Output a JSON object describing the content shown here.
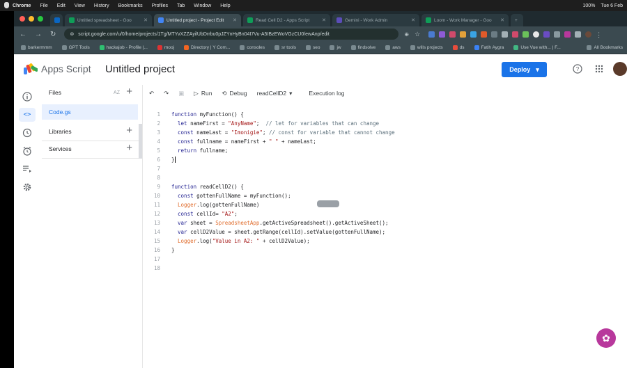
{
  "mac_menu": {
    "app": "Chrome",
    "items": [
      "File",
      "Edit",
      "View",
      "History",
      "Bookmarks",
      "Profiles",
      "Tab",
      "Window",
      "Help"
    ],
    "battery": "100%",
    "clock": "Tue 6 Feb"
  },
  "browser": {
    "tabs": [
      {
        "label": "Untitled spreadsheet - Goo"
      },
      {
        "label": "Untitled project - Project Edit"
      },
      {
        "label": "Read Cell D2 - Apps Script"
      },
      {
        "label": "Gemini - Work Admin"
      },
      {
        "label": "Loom - Work Manager - Goo"
      }
    ],
    "url": "script.google.com/u/0/home/projects/1Tg/MTYvXZZAyilUbDrrbu0pJZYnHyBn04I7Vu-A5IBzEWoVGzCU0/ewAnp/edit",
    "bookmarks": [
      "barkermmm",
      "GPT Tools",
      "hackajob - Profile |...",
      "mooj",
      "Directory | Y Com...",
      "consoles",
      "sr tools",
      "seo",
      "jw",
      "findsolve",
      "aws",
      "wills projects",
      "ds",
      "Fatih Aygra",
      "Use Vue with... | F..."
    ],
    "all_bookmarks": "All Bookmarks"
  },
  "app": {
    "product_name": "Apps Script",
    "project_title": "Untitled project",
    "deploy_label": "Deploy",
    "brand_color": "#1a73e8"
  },
  "file_panel": {
    "files_label": "Files",
    "sort_label": "AZ",
    "files": [
      "Code.gs"
    ],
    "libraries_label": "Libraries",
    "services_label": "Services"
  },
  "toolbar": {
    "run_label": "Run",
    "debug_label": "Debug",
    "function_select": "readCellD2",
    "execution_log_label": "Execution log"
  },
  "code_lines": [
    {
      "n": "1",
      "text": "function myFunction() {"
    },
    {
      "n": "2",
      "text": "  let nameFirst = \"AnyName\";  // let for variables that can change"
    },
    {
      "n": "3",
      "text": "  const nameLast = \"Imonigie\"; // const for variable that cannot change"
    },
    {
      "n": "4",
      "text": "  const fullname = nameFirst + \" \" + nameLast;"
    },
    {
      "n": "5",
      "text": "  return fullname;"
    },
    {
      "n": "6",
      "text": "}"
    },
    {
      "n": "7",
      "text": ""
    },
    {
      "n": "8",
      "text": ""
    },
    {
      "n": "9",
      "text": "function readCellD2() {"
    },
    {
      "n": "10",
      "text": "  const gottenFullName = myFunction();"
    },
    {
      "n": "11",
      "text": "  Logger.log(gottenFullName)"
    },
    {
      "n": "12",
      "text": "  const cellId= \"A2\";"
    },
    {
      "n": "13",
      "text": "  var sheet = SpreadsheetApp.getActiveSpreadsheet().getActiveSheet();"
    },
    {
      "n": "14",
      "text": "  var cellD2Value = sheet.getRange(cellId).setValue(gottenFullName);"
    },
    {
      "n": "15",
      "text": "  Logger.log(\"Value in A2: \" + cellD2Value);"
    },
    {
      "n": "16",
      "text": "}"
    },
    {
      "n": "17",
      "text": ""
    },
    {
      "n": "18",
      "text": ""
    }
  ]
}
